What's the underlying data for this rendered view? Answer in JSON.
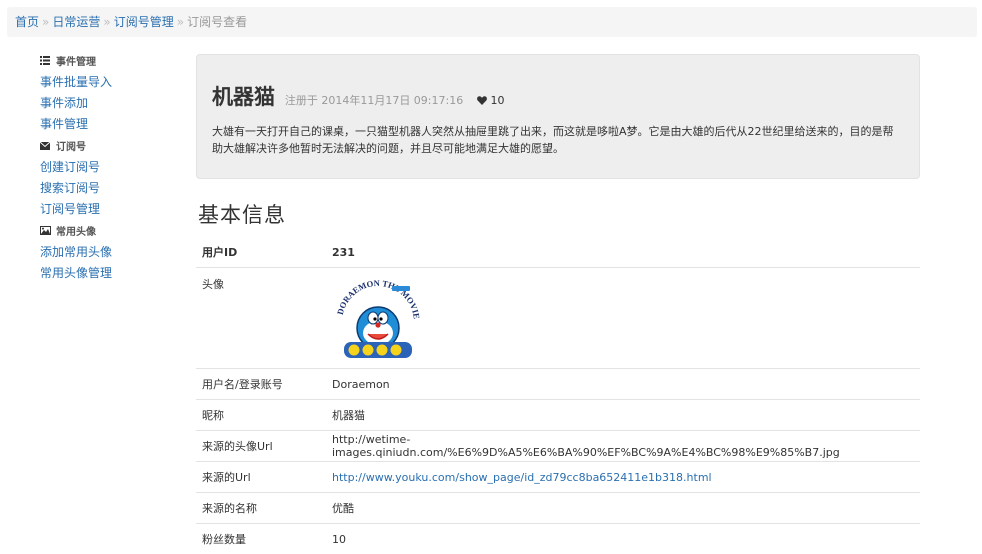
{
  "breadcrumb": {
    "items": [
      "首页",
      "日常运营",
      "订阅号管理"
    ],
    "separator": "»",
    "active": "订阅号查看"
  },
  "sidebar": {
    "groups": [
      {
        "header": "事件管理",
        "icon": "list-icon",
        "links": [
          "事件批量导入",
          "事件添加",
          "事件管理"
        ]
      },
      {
        "header": "订阅号",
        "icon": "envelope-icon",
        "links": [
          "创建订阅号",
          "搜索订阅号",
          "订阅号管理"
        ]
      },
      {
        "header": "常用头像",
        "icon": "picture-icon",
        "links": [
          "添加常用头像",
          "常用头像管理"
        ]
      }
    ]
  },
  "hero": {
    "title": "机器猫",
    "registered": "注册于 2014年11月17日 09:17:16",
    "heart_icon": "heart-icon",
    "likes": "10",
    "description": "大雄有一天打开自己的课桌，一只猫型机器人突然从抽屉里跳了出来，而这就是哆啦A梦。它是由大雄的后代从22世纪里给送来的，目的是帮助大雄解决许多他暂时无法解决的问题，并且尽可能地满足大雄的愿望。"
  },
  "section": {
    "title": "基本信息"
  },
  "info": {
    "user_id_label": "用户ID",
    "user_id": "231",
    "avatar_label": "头像",
    "avatar_text": "DORAEMON THE MOVIE",
    "username_label": "用户名/登录账号",
    "username": "Doraemon",
    "nickname_label": "昵称",
    "nickname": "机器猫",
    "avatar_url_label": "来源的头像Url",
    "avatar_url": "http://wetime-images.qiniudn.com/%E6%9D%A5%E6%BA%90%EF%BC%9A%E4%BC%98%E9%85%B7.jpg",
    "source_url_label": "来源的Url",
    "source_url": "http://www.youku.com/show_page/id_zd79cc8ba652411e1b318.html",
    "source_name_label": "来源的名称",
    "source_name": "优酷",
    "fans_label": "粉丝数量",
    "fans": "10"
  },
  "colors": {
    "link": "#2a6fb0",
    "hero_bg": "#eeeeee",
    "breadcrumb_bg": "#f5f5f5"
  }
}
